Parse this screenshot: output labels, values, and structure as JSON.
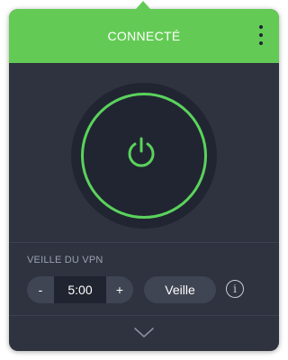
{
  "header": {
    "status": "CONNECTÉ",
    "menu_icon": "vertical-dots-icon",
    "background_color": "#63cb55"
  },
  "power": {
    "icon": "power-icon",
    "state": "on",
    "ring_color": "#5ad35c"
  },
  "sleep": {
    "section_label": "VEILLE DU VPN",
    "decrement_label": "-",
    "increment_label": "+",
    "duration": "5:00",
    "sleep_button_label": "Veille",
    "info_icon_glyph": "i"
  },
  "footer": {
    "expand_icon": "chevron-down-icon"
  },
  "colors": {
    "panel_background": "#2f333f",
    "accent_green": "#63cb55"
  }
}
